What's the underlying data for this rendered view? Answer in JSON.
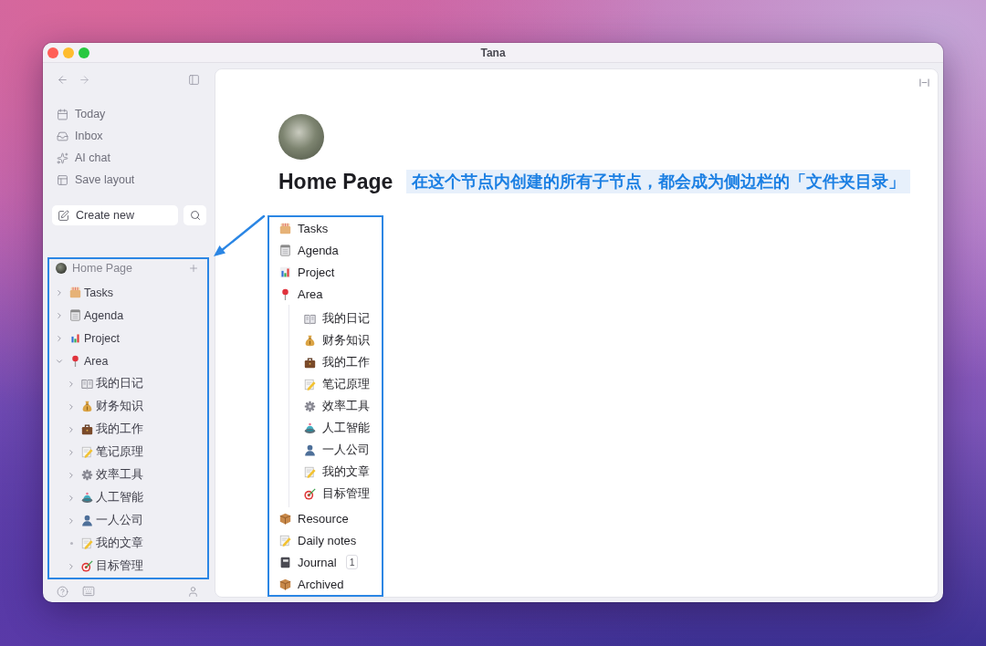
{
  "window": {
    "title": "Tana"
  },
  "sidebar": {
    "nav": [
      {
        "label": "Today",
        "kind": "calendar"
      },
      {
        "label": "Inbox",
        "kind": "inbox"
      },
      {
        "label": "AI chat",
        "kind": "sparkle"
      },
      {
        "label": "Save layout",
        "kind": "layout"
      }
    ],
    "create_button": "Create new",
    "tree": {
      "title": "Home Page",
      "highlighted": true,
      "items": [
        {
          "label": "Tasks",
          "kind": "filebox",
          "expandable": true,
          "expanded": false
        },
        {
          "label": "Agenda",
          "kind": "notepad",
          "expandable": true,
          "expanded": false
        },
        {
          "label": "Project",
          "kind": "chart",
          "expandable": true,
          "expanded": false
        },
        {
          "label": "Area",
          "kind": "pin",
          "expandable": true,
          "expanded": true,
          "children": [
            {
              "label": "我的日记",
              "kind": "book",
              "expandable": true,
              "expanded": false
            },
            {
              "label": "财务知识",
              "kind": "moneybag",
              "expandable": true,
              "expanded": false
            },
            {
              "label": "我的工作",
              "kind": "briefcase",
              "expandable": true,
              "expanded": false
            },
            {
              "label": "笔记原理",
              "kind": "memo",
              "expandable": true,
              "expanded": false
            },
            {
              "label": "效率工具",
              "kind": "gear",
              "expandable": true,
              "expanded": false
            },
            {
              "label": "人工智能",
              "kind": "saucer",
              "expandable": true,
              "expanded": false
            },
            {
              "label": "一人公司",
              "kind": "person",
              "expandable": true,
              "expanded": false
            },
            {
              "label": "我的文章",
              "kind": "memo",
              "expandable": false,
              "expanded": false
            },
            {
              "label": "目标管理",
              "kind": "target",
              "expandable": true,
              "expanded": false
            }
          ]
        }
      ]
    }
  },
  "page": {
    "title": "Home Page",
    "annotation": "在这个节点内创建的所有子节点，都会成为侧边栏的「文件夹目录」",
    "list": {
      "highlighted": true,
      "nodes": [
        {
          "label": "Tasks",
          "kind": "filebox"
        },
        {
          "label": "Agenda",
          "kind": "notepad"
        },
        {
          "label": "Project",
          "kind": "chart"
        },
        {
          "label": "Area",
          "kind": "pin",
          "children": [
            {
              "label": "我的日记",
              "kind": "book"
            },
            {
              "label": "财务知识",
              "kind": "moneybag"
            },
            {
              "label": "我的工作",
              "kind": "briefcase"
            },
            {
              "label": "笔记原理",
              "kind": "memo"
            },
            {
              "label": "效率工具",
              "kind": "gear"
            },
            {
              "label": "人工智能",
              "kind": "saucer"
            },
            {
              "label": "一人公司",
              "kind": "person"
            },
            {
              "label": "我的文章",
              "kind": "memo"
            },
            {
              "label": "目标管理",
              "kind": "target"
            }
          ]
        },
        {
          "label": "Resource",
          "kind": "package"
        },
        {
          "label": "Daily notes",
          "kind": "memo"
        },
        {
          "label": "Journal",
          "kind": "notebook",
          "count": "1"
        },
        {
          "label": "Archived",
          "kind": "package"
        }
      ]
    }
  }
}
